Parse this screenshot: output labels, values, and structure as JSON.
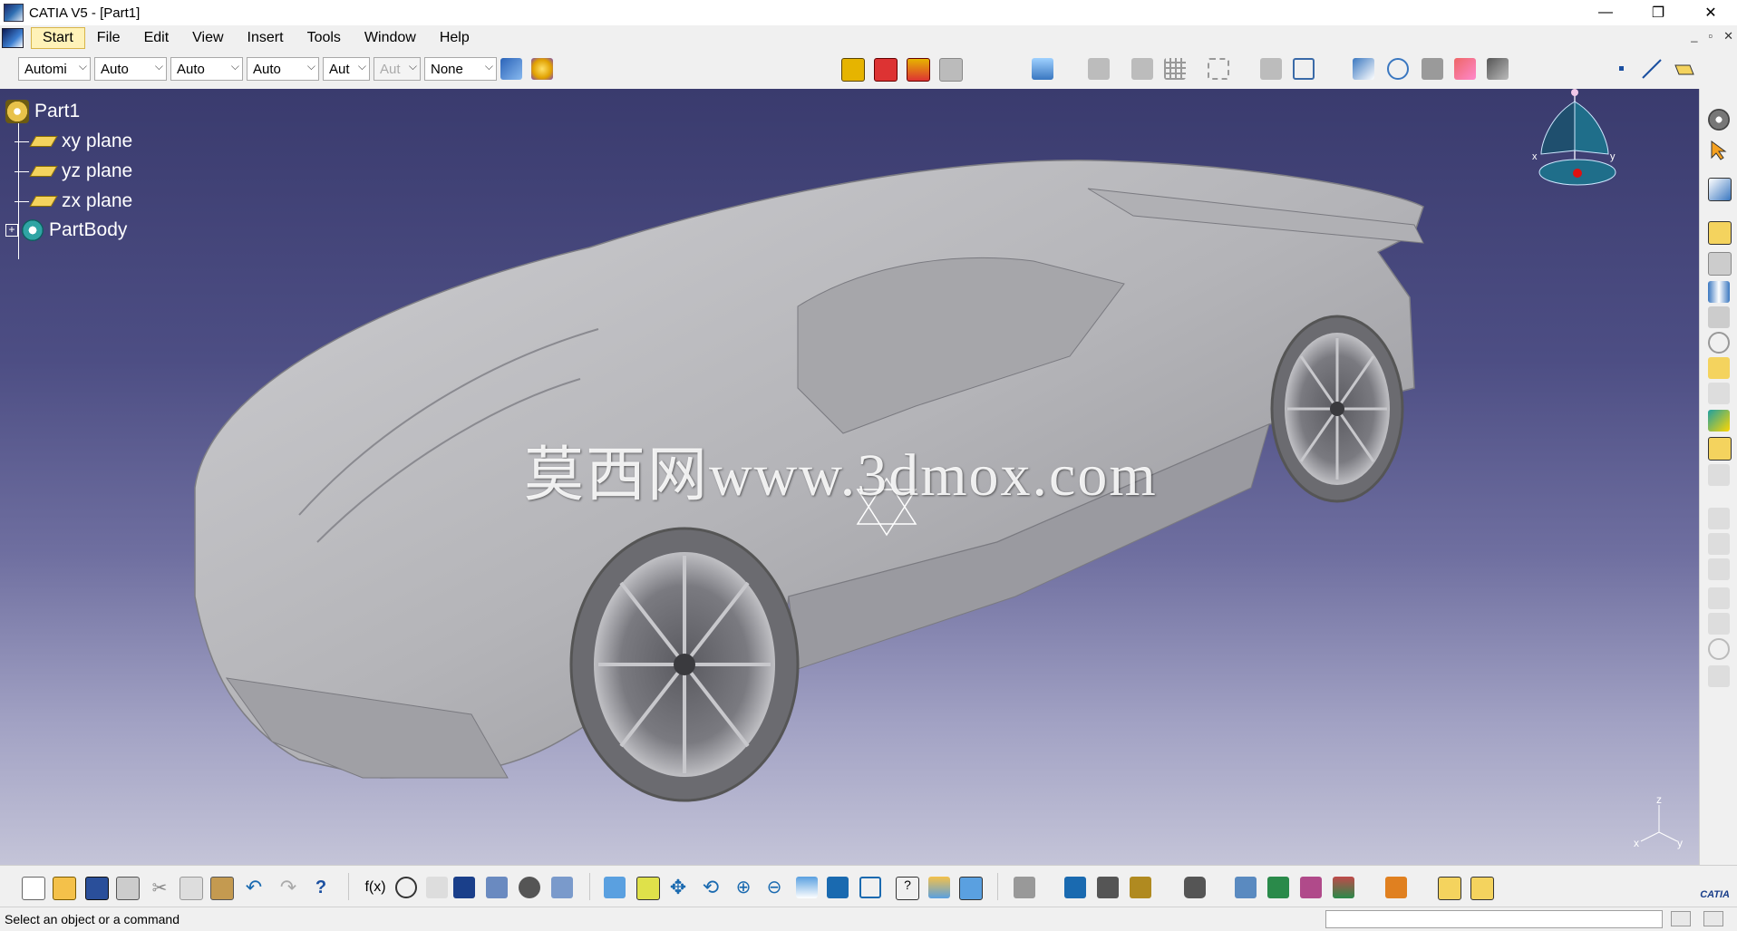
{
  "window": {
    "title": "CATIA V5 - [Part1]",
    "controls": [
      "—",
      "❐",
      "✕"
    ],
    "doc_controls": [
      "_",
      "▫",
      "✕"
    ]
  },
  "menu": [
    {
      "label": "Start",
      "active": true
    },
    {
      "label": "File"
    },
    {
      "label": "Edit"
    },
    {
      "label": "View"
    },
    {
      "label": "Insert"
    },
    {
      "label": "Tools"
    },
    {
      "label": "Window"
    },
    {
      "label": "Help"
    }
  ],
  "toolbar_top": {
    "combos": [
      {
        "value": "Automi",
        "enabled": true
      },
      {
        "value": "Auto",
        "enabled": true
      },
      {
        "value": "Auto",
        "enabled": true
      },
      {
        "value": "Auto",
        "enabled": true
      },
      {
        "value": "Aut",
        "enabled": true
      },
      {
        "value": "Aut",
        "enabled": false
      },
      {
        "value": "None",
        "enabled": true
      }
    ],
    "icons": [
      "painter-icon",
      "color-wand-icon",
      "render-style-1-icon",
      "render-style-2-icon",
      "render-style-3-icon",
      "render-style-4-icon",
      "layer-icon",
      "swap-view-icon",
      "mirror-icon",
      "grid-icon",
      "fit-all-icon",
      "duplicate-icon",
      "table-icon",
      "text-abc-icon",
      "arrow-leader-icon",
      "hide-show-icon",
      "material-icon",
      "measure-icon",
      "point-icon",
      "line-icon",
      "plane-icon"
    ]
  },
  "tree": {
    "root": "Part1",
    "items": [
      {
        "label": "xy plane",
        "icon": "plane-icon"
      },
      {
        "label": "yz plane",
        "icon": "plane-icon"
      },
      {
        "label": "zx plane",
        "icon": "plane-icon"
      },
      {
        "label": "PartBody",
        "icon": "gear-icon"
      }
    ]
  },
  "viewport": {
    "watermark": "莫西网www.3dmox.com",
    "compass_labels": {
      "x": "x",
      "y": "y"
    },
    "axis_labels": {
      "x": "x",
      "y": "y",
      "z": "z"
    }
  },
  "colors": {
    "viewport_top": "#3a3b6e",
    "viewport_bottom": "#c4c4d8",
    "car_body": "#b8b8bb",
    "tree_text": "#ffffff",
    "plane_icon": "#f4d35e",
    "compass": "#1f6e8a"
  },
  "toolbar_right": {
    "icons": [
      "gear-settings-icon",
      "select-arrow-icon",
      "sketch-icon",
      "pad-icon",
      "pocket-icon",
      "shaft-icon",
      "groove-icon",
      "hole-icon",
      "rib-icon",
      "slot-icon",
      "stiffener-icon",
      "loft-icon",
      "fillet-icon",
      "chamfer-icon",
      "draft-icon",
      "shell-icon",
      "thickness-icon",
      "thread-icon",
      "remove-face-icon",
      "replace-face-icon"
    ]
  },
  "toolbar_bottom": {
    "icons": [
      "new-icon",
      "open-icon",
      "save-icon",
      "print-icon",
      "cut-icon",
      "copy-icon",
      "paste-icon",
      "undo-icon",
      "redo-icon",
      "whats-this-icon",
      "formula-icon",
      "comment-icon",
      "knowledge-icon",
      "table-icon",
      "parameters-icon",
      "catalog-icon",
      "scan-icon",
      "fly-mode-icon",
      "fit-all-icon",
      "pan-icon",
      "rotate-icon",
      "zoom-in-icon",
      "zoom-out-icon",
      "normal-view-icon",
      "multi-view-icon",
      "isometric-view-icon",
      "view-mode-icon",
      "shading-icon",
      "hide-show-icon",
      "swap-visible-icon",
      "apply-material-icon",
      "measure-between-icon",
      "measure-item-icon",
      "measure-inertia-icon",
      "capture-icon",
      "render-icon",
      "analysis-icon",
      "sketch-analysis-icon",
      "draft-analysis-icon",
      "layers-icon",
      "tools-icon",
      "workbench-icon"
    ],
    "catia_logo": "CATIA"
  },
  "status": {
    "text": "Select an object or a command",
    "input_value": ""
  }
}
